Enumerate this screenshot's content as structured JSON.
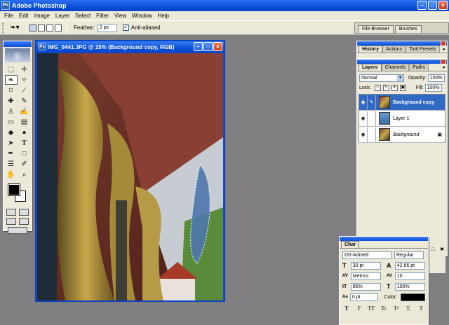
{
  "window": {
    "title": "Adobe Photoshop",
    "app_icon": "Ps",
    "minimize_glyph": "–",
    "maximize_glyph": "□",
    "close_glyph": "×"
  },
  "menubar": {
    "items": [
      "File",
      "Edit",
      "Image",
      "Layer",
      "Select",
      "Filter",
      "View",
      "Window",
      "Help"
    ]
  },
  "options": {
    "tool_preset_icon": "lasso-icon",
    "tool_preset_glyph": "❧▾",
    "feather_label": "Feather:",
    "feather_value": "2 px",
    "anti_alias_label": "Anti-aliased",
    "anti_alias_check": "✓",
    "palette_well_tabs": [
      "File Browser",
      "Brushes"
    ]
  },
  "toolbox": {
    "logo_glyph": "◎",
    "tools": [
      {
        "name": "marquee-tool",
        "icon": "marquee-icon",
        "glyph": "⬚"
      },
      {
        "name": "move-tool",
        "icon": "move-icon",
        "glyph": "✛"
      },
      {
        "name": "lasso-tool",
        "icon": "lasso-icon",
        "glyph": "❧",
        "selected": true
      },
      {
        "name": "magic-wand-tool",
        "icon": "magic-wand-icon",
        "glyph": "✧"
      },
      {
        "name": "crop-tool",
        "icon": "crop-icon",
        "glyph": "⌑"
      },
      {
        "name": "slice-tool",
        "icon": "slice-icon",
        "glyph": "∕"
      },
      {
        "name": "healing-brush-tool",
        "icon": "bandage-icon",
        "glyph": "✚"
      },
      {
        "name": "brush-tool",
        "icon": "brush-icon",
        "glyph": "✎"
      },
      {
        "name": "clone-stamp-tool",
        "icon": "stamp-icon",
        "glyph": "♙"
      },
      {
        "name": "history-brush-tool",
        "icon": "history-brush-icon",
        "glyph": "✍"
      },
      {
        "name": "eraser-tool",
        "icon": "eraser-icon",
        "glyph": "▭"
      },
      {
        "name": "gradient-tool",
        "icon": "gradient-icon",
        "glyph": "▤"
      },
      {
        "name": "blur-tool",
        "icon": "droplet-icon",
        "glyph": "◆"
      },
      {
        "name": "dodge-tool",
        "icon": "dodge-icon",
        "glyph": "●"
      },
      {
        "name": "path-selection-tool",
        "icon": "arrow-icon",
        "glyph": "➤"
      },
      {
        "name": "type-tool",
        "icon": "type-icon",
        "glyph": "T"
      },
      {
        "name": "pen-tool",
        "icon": "pen-icon",
        "glyph": "✒"
      },
      {
        "name": "shape-tool",
        "icon": "rectangle-icon",
        "glyph": "□"
      },
      {
        "name": "notes-tool",
        "icon": "note-icon",
        "glyph": "☰"
      },
      {
        "name": "eyedropper-tool",
        "icon": "eyedropper-icon",
        "glyph": "✐"
      },
      {
        "name": "hand-tool",
        "icon": "hand-icon",
        "glyph": "✋"
      },
      {
        "name": "zoom-tool",
        "icon": "zoom-icon",
        "glyph": "⌕"
      }
    ],
    "foreground_color": "#000000",
    "background_color": "#ffffff"
  },
  "document": {
    "title": "IMG_0441.JPG @ 25% (Background copy, RGB)",
    "icon": "Ps"
  },
  "history_panel": {
    "tabs": [
      "History",
      "Actions",
      "Tool Presets"
    ],
    "active_tab": "History",
    "menu_glyph": "▸"
  },
  "layers_panel": {
    "tabs": [
      "Layers",
      "Channels",
      "Paths"
    ],
    "active_tab": "Layers",
    "menu_glyph": "▸",
    "blend_mode": "Normal",
    "opacity_label": "Opacity:",
    "opacity_value": "100%",
    "lock_label": "Lock:",
    "fill_label": "Fill:",
    "fill_value": "100%",
    "select_arrow": "▾",
    "eye_glyph": "◉",
    "brush_glyph": "✎",
    "lock_glyph": "▣",
    "lock_icons": [
      "□",
      "✎",
      "✛",
      "▣"
    ],
    "layers": [
      {
        "name": "Background copy",
        "selected": true,
        "visible": true,
        "thumb": "photo"
      },
      {
        "name": "Layer 1",
        "selected": false,
        "visible": true,
        "thumb": "blue"
      },
      {
        "name": "Background",
        "selected": false,
        "visible": true,
        "thumb": "photo",
        "italic": true,
        "locked": true
      }
    ],
    "footer_icons": [
      "●",
      "▣",
      "◑",
      "▤",
      "▲",
      "□",
      "✖"
    ]
  },
  "character_panel": {
    "tab": "Char",
    "font_family": "DS-Admed",
    "font_style": "Regular",
    "size_icon": "T",
    "size": "30 pt",
    "leading_icon": "A",
    "leading": "42.66 pt",
    "kerning_icon": "AV",
    "kerning": "Metrics",
    "tracking_icon": "AV",
    "tracking": "10",
    "vscale_icon": "IT",
    "vertical_scale": "85%",
    "hscale_icon": "T",
    "horizontal_scale": "100%",
    "baseline_icon": "Aa",
    "baseline_shift": "0 pt",
    "color_label": "Color:",
    "color_value": "#000000",
    "style_buttons": [
      "T",
      "T",
      "TT",
      "Tr",
      "T¹",
      "T,",
      "T"
    ]
  }
}
